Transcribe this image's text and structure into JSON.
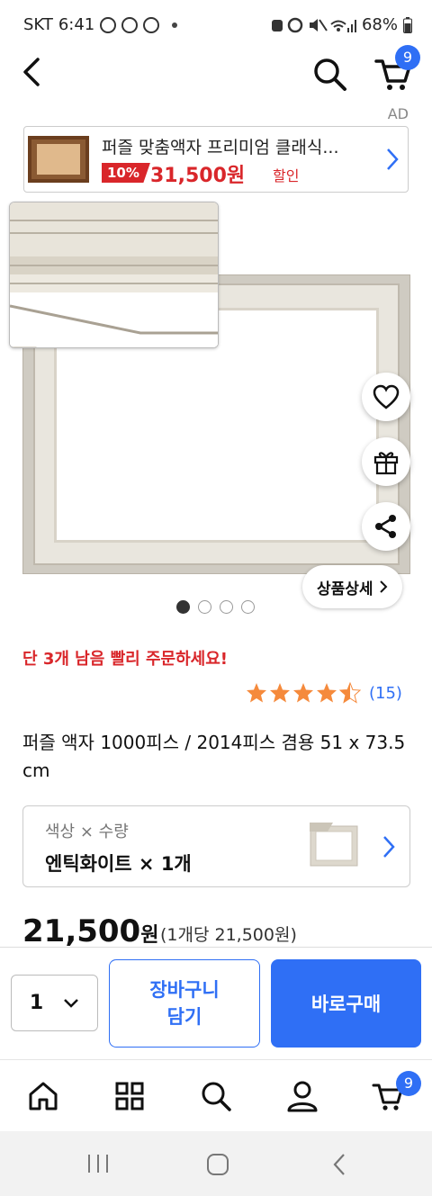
{
  "status": {
    "carrier": "SKT",
    "time": "6:41",
    "battery": "68%"
  },
  "header": {
    "cart_count": "9"
  },
  "ad": {
    "label": "AD",
    "title": "퍼즐 맞춤액자 프리미엄 클래식...",
    "discount": "10%",
    "price": "31,500원",
    "sale": "할인"
  },
  "product": {
    "detail_button": "상품상세",
    "gallery_count": 4,
    "gallery_index": 1,
    "hurry": "단 3개 남음 빨리 주문하세요!",
    "rating": 4.5,
    "review_count": "(15)",
    "title": "퍼즐 액자 1000피스 / 2014피스 겸용 51 x 73.5 cm"
  },
  "option": {
    "label": "색상 × 수량",
    "value": "엔틱화이트 × 1개"
  },
  "price": {
    "amount": "21,500",
    "currency": "원",
    "unit": "(1개당 21,500원)"
  },
  "buy": {
    "quantity": "1",
    "cart_line1": "장바구니",
    "cart_line2": "담기",
    "buy_now": "바로구매"
  },
  "tabs": [
    "home-icon",
    "category-grid-icon",
    "search-icon",
    "profile-icon",
    "cart-icon"
  ],
  "tab_cart_count": "9",
  "colors": {
    "accent": "#2f6ff5",
    "sale": "#d9262a",
    "star": "#f58a3c"
  }
}
